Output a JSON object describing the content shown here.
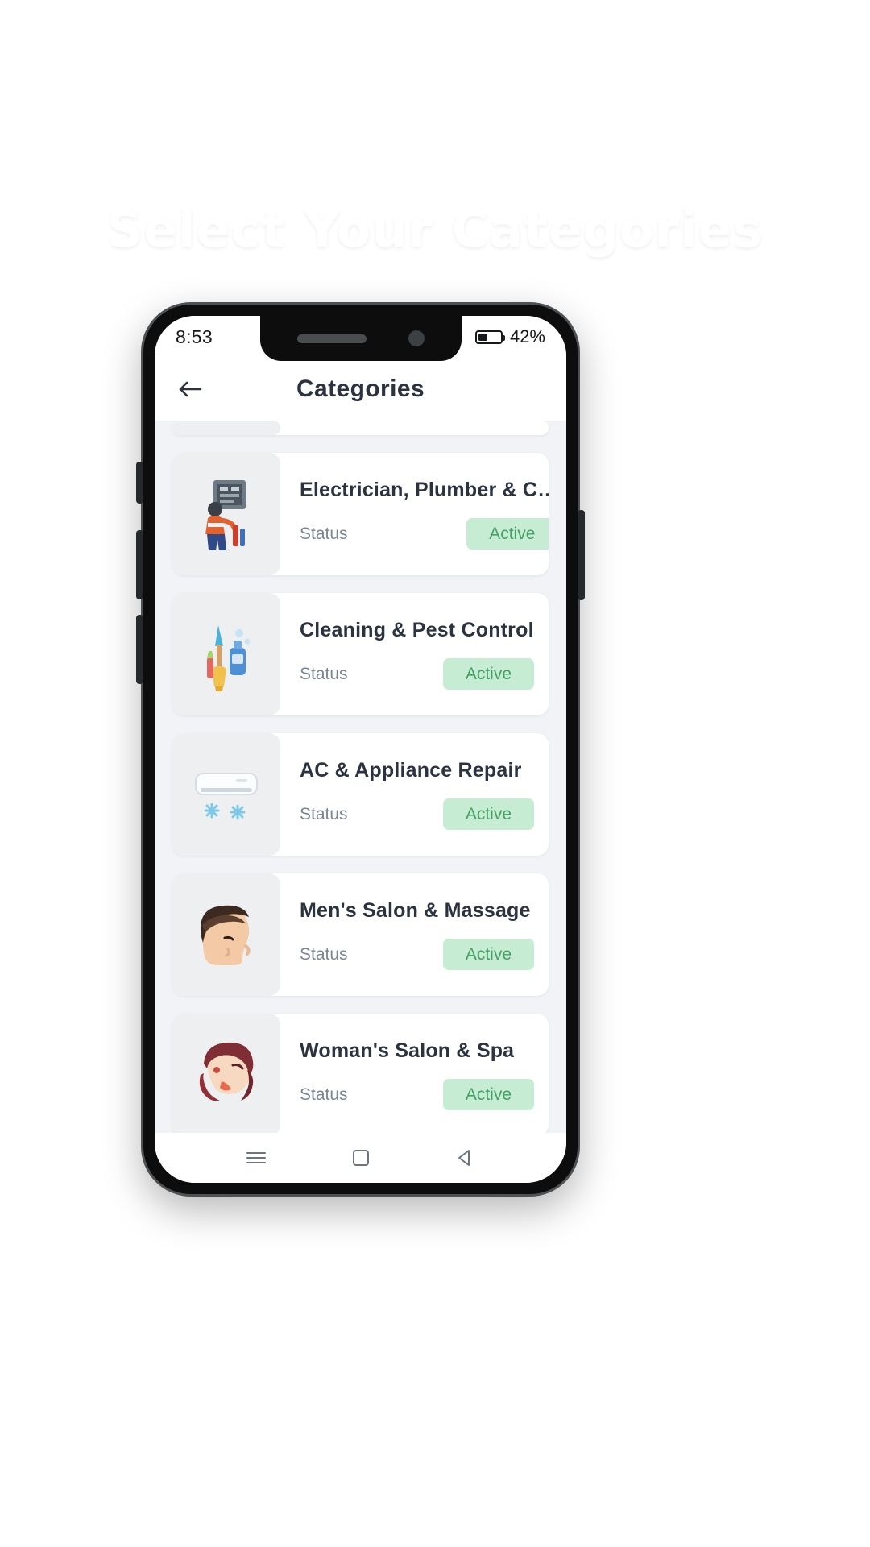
{
  "promo": {
    "headline": "Select Your Categories",
    "illustration": "checklist-with-tap-hand-icon",
    "bg_gradient_from": "#16bcd4",
    "bg_gradient_mid": "#8fdb86",
    "bg_gradient_to": "#f7d337"
  },
  "phone": {
    "status_bar": {
      "time": "8:53",
      "battery_percent": "42%",
      "battery_level": 42
    },
    "app_bar": {
      "back_icon": "arrow-left-icon",
      "title": "Categories"
    },
    "nav_bar": {
      "recents_icon": "menu-icon",
      "home_icon": "square-icon",
      "back_icon": "triangle-back-icon"
    },
    "list": {
      "status_label": "Status",
      "badge_label": "Active",
      "badge_bg": "#c7ecd4",
      "badge_text_color": "#45a163",
      "items": [
        {
          "title": "Electrician, Plumber & C…",
          "icon": "electrician-plumber-icon",
          "status_label": "Status",
          "badge_label": "Active"
        },
        {
          "title": "Cleaning & Pest Control",
          "icon": "cleaning-supplies-icon",
          "status_label": "Status",
          "badge_label": "Active"
        },
        {
          "title": "AC & Appliance Repair",
          "icon": "air-conditioner-icon",
          "status_label": "Status",
          "badge_label": "Active"
        },
        {
          "title": "Men's Salon & Massage",
          "icon": "mens-haircut-icon",
          "status_label": "Status",
          "badge_label": "Active"
        },
        {
          "title": "Woman's Salon & Spa",
          "icon": "womans-salon-icon",
          "status_label": "Status",
          "badge_label": "Active"
        }
      ]
    }
  }
}
